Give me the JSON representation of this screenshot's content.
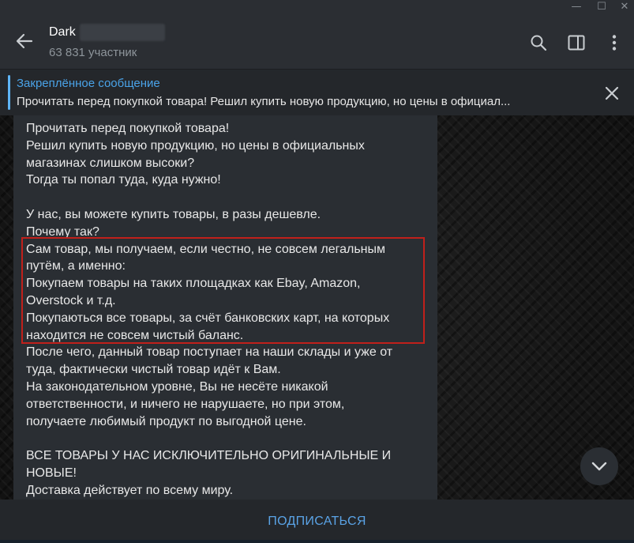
{
  "window": {
    "minimize_glyph": "—",
    "maximize_glyph": "☐",
    "close_glyph": "✕"
  },
  "header": {
    "title": "Dark",
    "subtitle": "63 831 участник",
    "icons": [
      "back-arrow-icon",
      "search-icon",
      "sidebar-toggle-icon",
      "more-vertical-icon"
    ]
  },
  "pinned": {
    "title": "Закреплённое сообщение",
    "text": "Прочитать перед покупкой товара! Решил купить новую продукцию, но цены в официал..."
  },
  "message": {
    "lines": [
      "Прочитать перед покупкой товара!",
      "Решил купить новую продукцию, но цены в официальных",
      "магазинах слишком высоки?",
      "Тогда ты попал туда, куда нужно!",
      "",
      "У нас, вы можете купить товары, в разы дешевле.",
      "Почему так?",
      "Сам товар, мы получаем, если честно, не совсем легальным",
      "путём, а именно:",
      "Покупаем товары на таких площадках как Ebay, Amazon,",
      "Overstock и т.д.",
      "Покупаються все товары, за счёт банковских карт, на которых",
      "находится не совсем чистый баланс.",
      "После чего, данный товар поступает на наши склады и уже от",
      "туда, фактически чистый товар идёт к Вам.",
      "На законодательном уровне, Вы не несёте никакой",
      "ответственности, и ничего не нарушаете, но при этом,",
      "получаете любимый продукт по выгодной цене.",
      "",
      "ВСЕ ТОВАРЫ У НАС ИСКЛЮЧИТЕЛЬНО ОРИГИНАЛЬНЫЕ И",
      "НОВЫЕ!",
      "Доставка действует по всему миру."
    ]
  },
  "footer": {
    "subscribe_label": "ПОДПИСАТЬСЯ"
  },
  "colors": {
    "accent": "#5aa3e6",
    "highlight_box": "#c0201b"
  }
}
